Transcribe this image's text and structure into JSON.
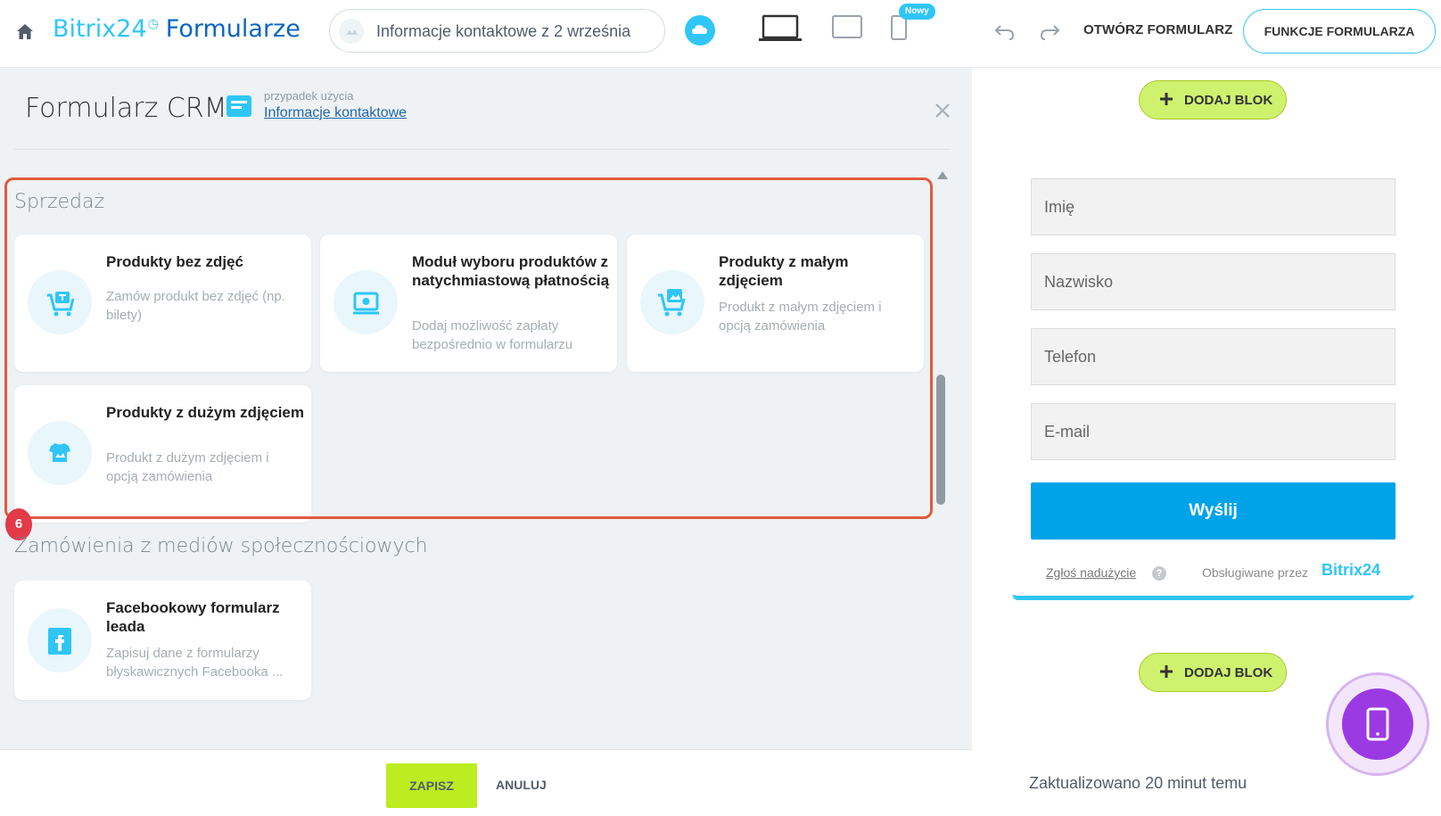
{
  "topbar": {
    "brand_b24": "Bitrix24",
    "brand_product": "Formularze",
    "page_selector": "Informacje kontaktowe z 2 września",
    "new_badge": "Nowy",
    "open_form": "OTWÓRZ FORMULARZ",
    "form_features": "FUNKCJE FORMULARZA"
  },
  "panel": {
    "title": "Formularz CRM",
    "usecase_caption": "przypadek użycia",
    "usecase_link": "Informacje kontaktowe"
  },
  "sections": [
    {
      "title": "Sprzedaż",
      "cards": [
        {
          "icon": "cart-ticket-icon",
          "title": "Produkty bez zdjęć",
          "desc": "Zamów produkt bez zdjęć (np. bilety)"
        },
        {
          "icon": "payment-icon",
          "title": "Moduł wyboru produktów z natychmiastową płatnością",
          "desc": "Dodaj możliwość zapłaty bezpośrednio w formularzu"
        },
        {
          "icon": "cart-image-icon",
          "title": "Produkty z małym zdjęciem",
          "desc": "Produkt z małym zdjęciem i opcją zamówienia"
        },
        {
          "icon": "shirt-icon",
          "title": "Produkty z dużym zdjęciem",
          "desc": "Produkt z dużym zdjęciem i opcją zamówienia"
        }
      ]
    },
    {
      "title": "Zamówienia z mediów społecznościowych",
      "cards": [
        {
          "icon": "facebook-icon",
          "title": "Facebookowy formularz leada",
          "desc": "Zapisuj dane z formularzy błyskawicznych Facebooka ..."
        }
      ]
    }
  ],
  "step_badge": "6",
  "footer": {
    "save": "ZAPISZ",
    "cancel": "ANULUJ"
  },
  "preview": {
    "add_block": "DODAJ BLOK",
    "fields": [
      "Imię",
      "Nazwisko",
      "Telefon",
      "E-mail"
    ],
    "submit": "Wyślij",
    "report_abuse": "Zgłoś nadużycie",
    "help": "?",
    "powered_by": "Obsługiwane przez",
    "powered_brand": "Bitrix24",
    "updated": "Zaktualizowano 20 minut temu"
  },
  "colors": {
    "accent": "#2fc6f6",
    "brand_blue": "#0b66c3",
    "highlight_frame": "#e25a3d",
    "save_green": "#bbed21",
    "submit_blue": "#00a2e8",
    "fab_purple": "#9b3ae3"
  }
}
